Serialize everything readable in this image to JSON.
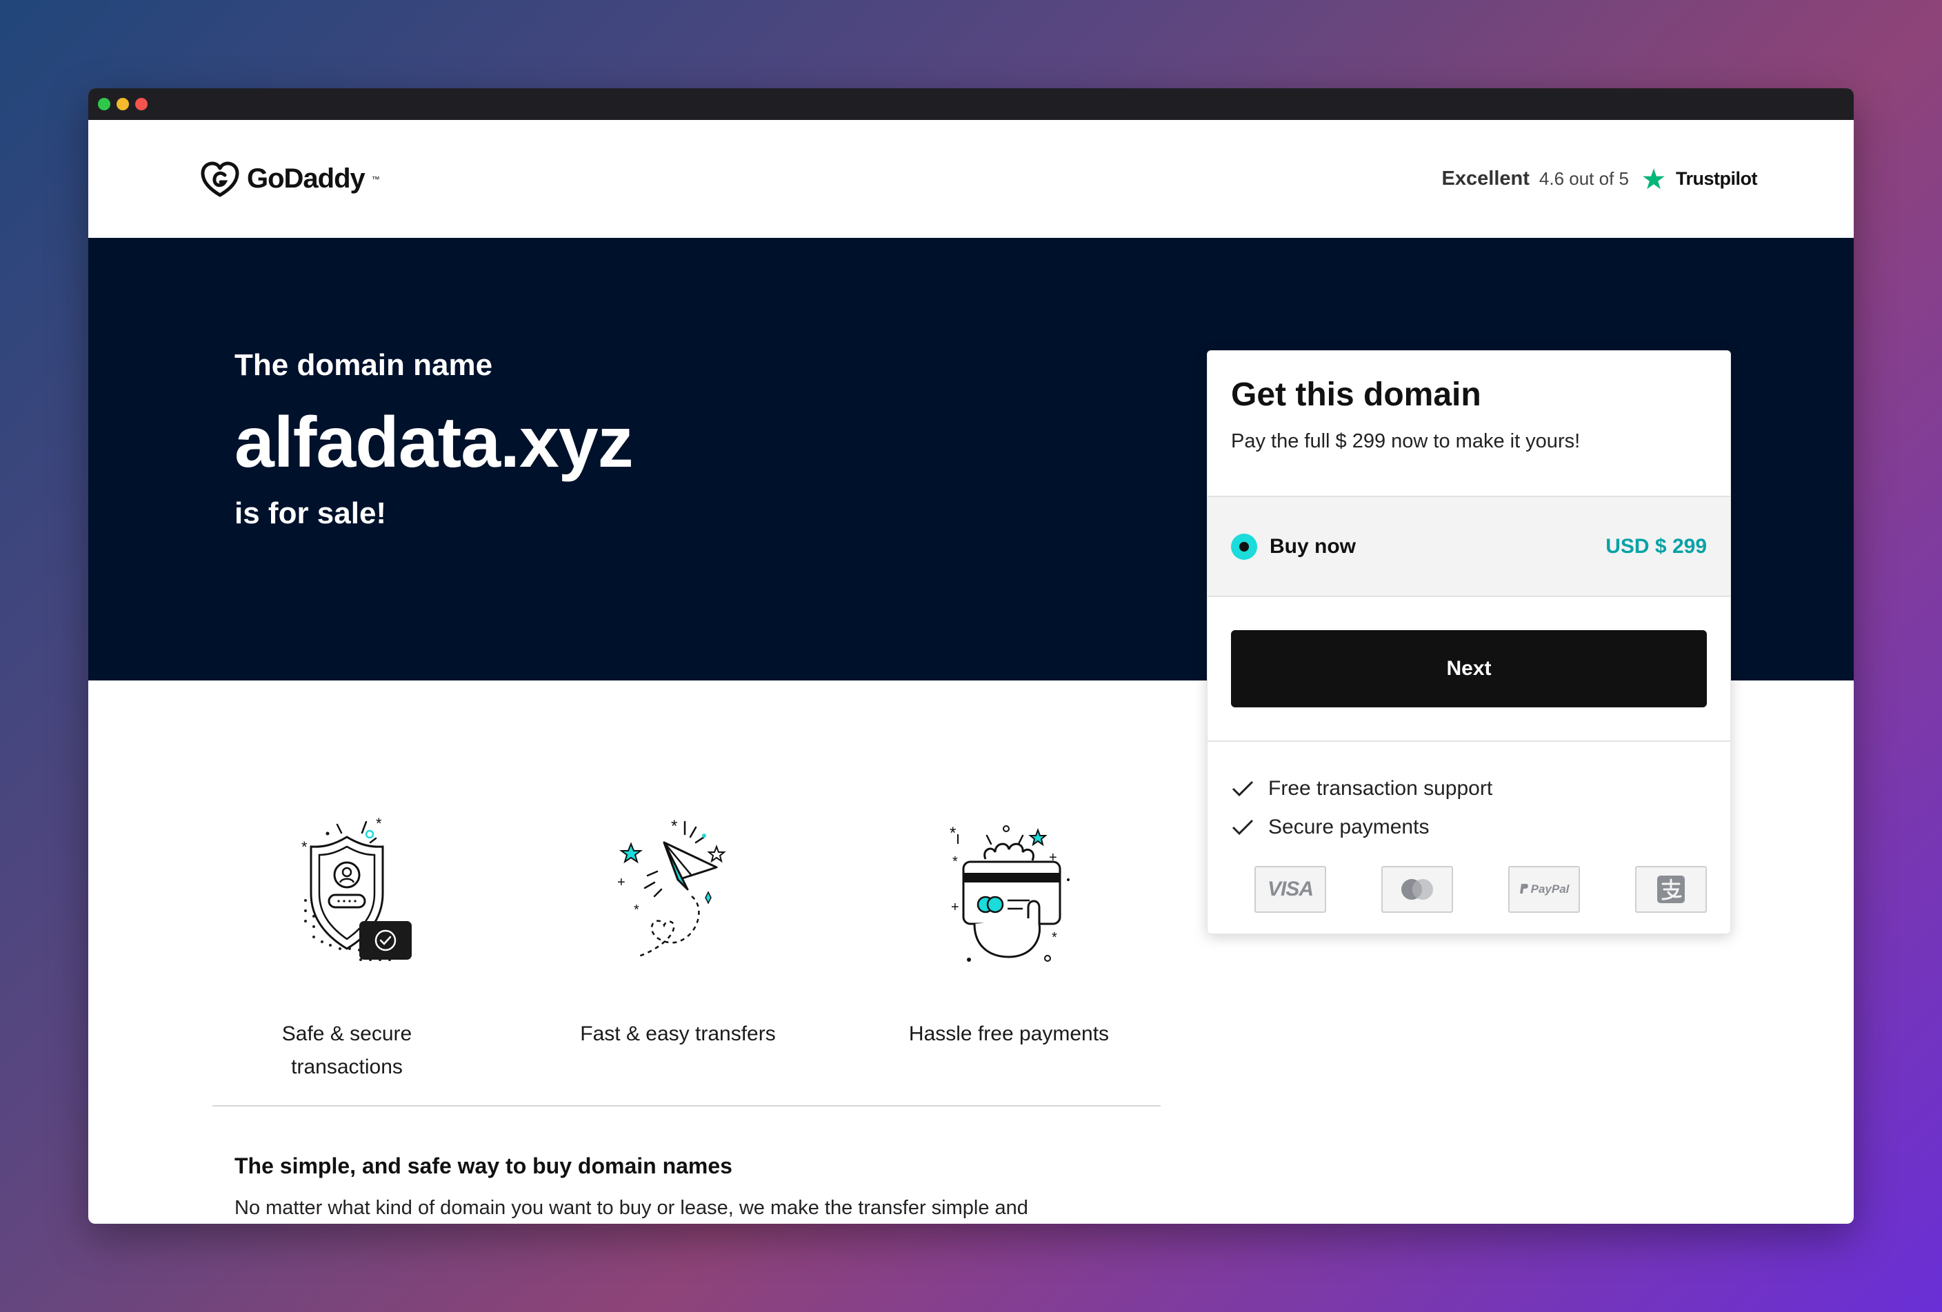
{
  "window": {
    "controls": [
      "green",
      "yellow",
      "red"
    ]
  },
  "header": {
    "logo_text": "GoDaddy",
    "logo_tm": "™",
    "rating_word": "Excellent",
    "rating_score": "4.6 out of 5",
    "rating_brand": "Trustpilot"
  },
  "hero": {
    "line1": "The domain name",
    "domain": "alfadata.xyz",
    "line2": "is for sale!"
  },
  "features": [
    {
      "label_line1": "Safe & secure",
      "label_line2": "transactions",
      "icon": "secure-shield-icon"
    },
    {
      "label_line1": "Fast & easy transfers",
      "label_line2": "",
      "icon": "paper-plane-icon"
    },
    {
      "label_line1": "Hassle free payments",
      "label_line2": "",
      "icon": "payment-card-icon"
    }
  ],
  "bottom": {
    "title": "The simple, and safe way to buy domain names",
    "body": "No matter what kind of domain you want to buy or lease, we make the transfer simple and"
  },
  "card": {
    "title": "Get this domain",
    "description": "Pay the full $ 299 now to make it yours!",
    "option_label": "Buy now",
    "option_price": "USD $ 299",
    "next_label": "Next",
    "perks": [
      "Free transaction support",
      "Secure payments"
    ],
    "payment_methods": [
      "visa",
      "mastercard",
      "paypal",
      "alipay"
    ],
    "visa_text": "VISA",
    "paypal_text": "PayPal"
  },
  "colors": {
    "hero_bg": "#00112b",
    "accent_teal": "#1bdbdb",
    "price_teal": "#09a2a6",
    "trustpilot_green": "#00b67a",
    "button_bg": "#111111"
  }
}
